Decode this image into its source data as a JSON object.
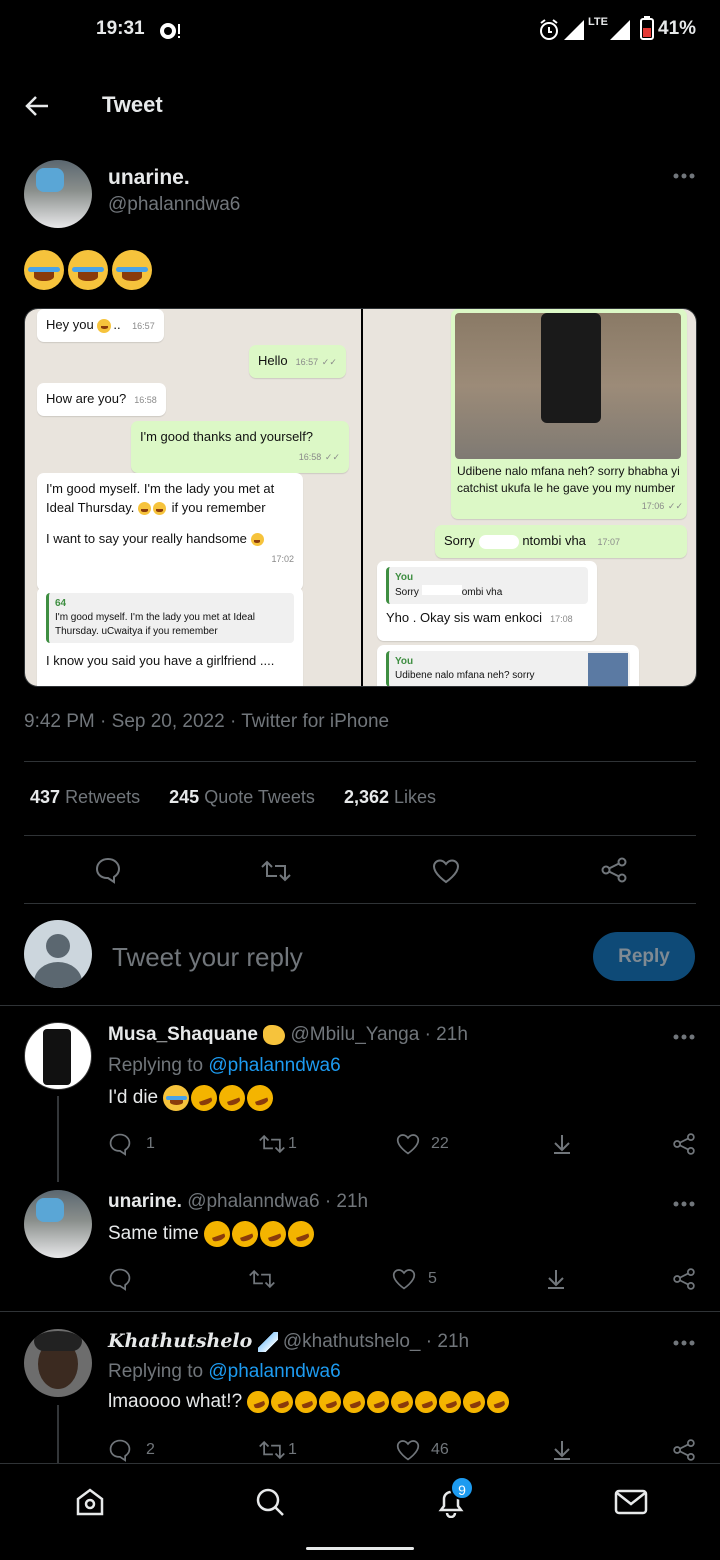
{
  "status": {
    "time": "19:31",
    "battery": "41%",
    "network": "LTE"
  },
  "header": {
    "title": "Tweet"
  },
  "tweet": {
    "name": "unarine.",
    "handle": "@phalanndwa6",
    "timestamp": "9:42 PM · Sep 20, 2022 · Twitter for iPhone",
    "chat_left": {
      "m1": "Hey you",
      "m1_time": "16:57",
      "m2": "Hello",
      "m2_time": "16:57",
      "m3": "How are you?",
      "m3_time": "16:58",
      "m4": "I'm good thanks and yourself?",
      "m4_time": "16:58",
      "m5": "I'm good myself. I'm the lady you met at Ideal Thursday.",
      "m5b": "if you remember",
      "m6": "I want to say your really handsome",
      "m6_time": "17:02",
      "quote_title": "64",
      "quote_text": "I'm good myself. I'm the lady you met at Ideal Thursday. uCwaitya if you remember",
      "m7": "I know you said you have a girlfriend ...."
    },
    "chat_right": {
      "m1": "Udibene nalo mfana neh? sorry bhabha yi catchist ukufa le he gave you my number",
      "m1_time": "17:06",
      "m2a": "Sorry",
      "m2b": "ntombi vha",
      "m2_time": "17:07",
      "q1_title": "You",
      "q1_text_a": "Sorry",
      "q1_text_b": "ombi vha",
      "m3": "Yho . Okay sis wam enkoci",
      "m3_time": "17:08",
      "q2_title": "You",
      "q2_text": "Udibene nalo mfana neh? sorry"
    }
  },
  "stats": {
    "retweets_num": "437",
    "retweets_label": "Retweets",
    "quotes_num": "245",
    "quotes_label": "Quote Tweets",
    "likes_num": "2,362",
    "likes_label": "Likes"
  },
  "reply_box": {
    "placeholder": "Tweet your reply",
    "button": "Reply"
  },
  "replies": [
    {
      "name": "Musa_Shaquane",
      "handle": "@Mbilu_Yanga",
      "time": "· 21h",
      "replying_prefix": "Replying to",
      "replying_to": "@phalanndwa6",
      "text": "I'd die",
      "comments": "1",
      "retweets": "1",
      "likes": "22"
    },
    {
      "name": "unarine.",
      "handle": "@phalanndwa6",
      "time": "· 21h",
      "text": "Same time",
      "comments": "",
      "retweets": "",
      "likes": "5"
    },
    {
      "name": "Khathutshelo",
      "handle": "@khathutshelo_",
      "time": "· 21h",
      "replying_prefix": "Replying to",
      "replying_to": "@phalanndwa6",
      "text": "lmaoooo what!?",
      "comments": "2",
      "retweets": "1",
      "likes": "46"
    }
  ],
  "nav": {
    "notifications_badge": "9"
  },
  "colors": {
    "accent": "#1d9bf0",
    "reply_button": "#0e4a77",
    "background": "#000000"
  }
}
